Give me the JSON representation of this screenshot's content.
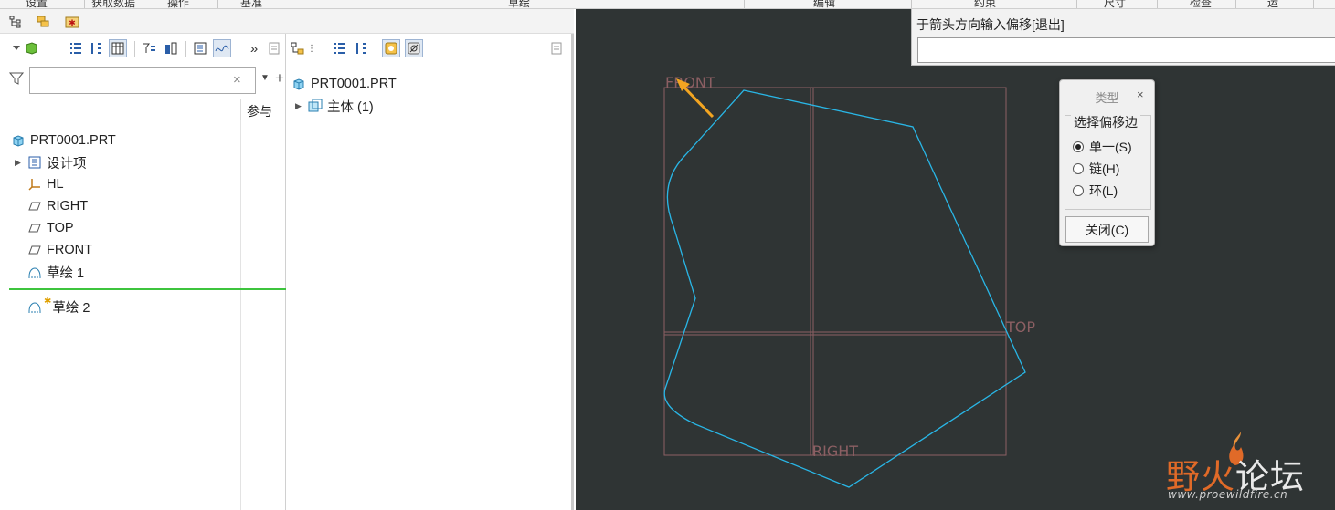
{
  "topbar": {
    "sections": [
      "设置",
      "获取数据",
      "操作",
      "基准",
      "草绘",
      "编辑",
      "约束",
      "尺寸",
      "检查",
      "运"
    ]
  },
  "left_panel": {
    "tabs": [
      "model-tree-icon",
      "layer-tree-icon",
      "favorites-icon"
    ],
    "filter": {
      "placeholder": "",
      "value": ""
    },
    "columns": {
      "ref": "参与"
    },
    "tree": [
      {
        "label": "PRT0001.PRT",
        "icon": "part-icon"
      },
      {
        "label": "设计项",
        "icon": "design-items-icon",
        "expandable": true
      },
      {
        "label": "HL",
        "icon": "csys-icon"
      },
      {
        "label": "RIGHT",
        "icon": "datum-plane-icon"
      },
      {
        "label": "TOP",
        "icon": "datum-plane-icon"
      },
      {
        "label": "FRONT",
        "icon": "datum-plane-icon"
      },
      {
        "label": "草绘 1",
        "icon": "sketch-icon"
      },
      {
        "label": "草绘 2",
        "icon": "sketch-active-icon"
      }
    ]
  },
  "body_panel": {
    "tree": [
      {
        "label": "PRT0001.PRT",
        "icon": "part-icon"
      },
      {
        "label": "主体 (1)",
        "icon": "body-icon",
        "expandable": true
      }
    ]
  },
  "canvas": {
    "background": "#2f3434",
    "datum_labels": {
      "front": "FRONT",
      "top": "TOP",
      "right": "RIGHT"
    },
    "datum_color": "#8c5f63",
    "sketch_color": "#29b6e6",
    "arrow_color": "#f3a521"
  },
  "message": {
    "text": "于箭头方向输入偏移[退出]",
    "input_value": ""
  },
  "dialog": {
    "title": "类型",
    "close_glyph": "×",
    "group_label": "选择偏移边",
    "options": [
      "单一(S)",
      "链(H)",
      "环(L)"
    ],
    "selected_index": 0,
    "close_button": "关闭(C)"
  },
  "watermark": {
    "brand_a": "野火",
    "brand_b": "论坛",
    "url": "www.proewildfire.cn"
  }
}
